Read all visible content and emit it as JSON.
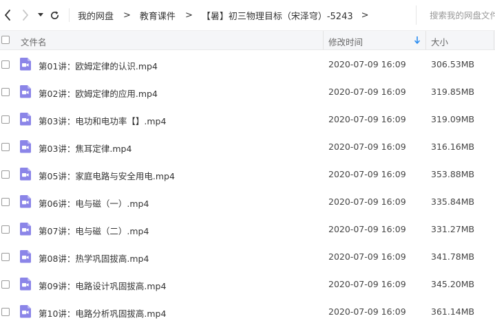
{
  "toolbar": {
    "breadcrumb": [
      "我的网盘",
      "教育课件",
      "【暑】初三物理目标（宋泽穹）-5243"
    ],
    "separator": ">",
    "search_placeholder": "搜索我的网盘文件"
  },
  "header": {
    "name_label": "文件名",
    "time_label": "修改时间",
    "size_label": "大小",
    "sort_icon": "arrow-down-icon"
  },
  "files": [
    {
      "name": "第01讲：欧姆定律的认识.mp4",
      "time": "2020-07-09 16:09",
      "size": "306.53MB"
    },
    {
      "name": "第02讲：欧姆定律的应用.mp4",
      "time": "2020-07-09 16:09",
      "size": "319.85MB"
    },
    {
      "name": "第03讲：电功和电功率【】.mp4",
      "time": "2020-07-09 16:09",
      "size": "319.09MB"
    },
    {
      "name": "第03讲：焦耳定律.mp4",
      "time": "2020-07-09 16:09",
      "size": "316.16MB"
    },
    {
      "name": "第05讲：家庭电路与安全用电.mp4",
      "time": "2020-07-09 16:09",
      "size": "353.88MB"
    },
    {
      "name": "第06讲：电与磁（一）.mp4",
      "time": "2020-07-09 16:09",
      "size": "335.84MB"
    },
    {
      "name": "第07讲：电与磁（二）.mp4",
      "time": "2020-07-09 16:09",
      "size": "331.27MB"
    },
    {
      "name": "第08讲：热学巩固拔高.mp4",
      "time": "2020-07-09 16:09",
      "size": "341.78MB"
    },
    {
      "name": "第09讲：电路设计巩固拔高.mp4",
      "time": "2020-07-09 16:09",
      "size": "345.20MB"
    },
    {
      "name": "第10讲：电路分析巩固拔高.mp4",
      "time": "2020-07-09 16:09",
      "size": "361.14MB"
    }
  ],
  "colors": {
    "video_icon": "#8b85e8",
    "sort_arrow": "#2a8cf0",
    "header_bg": "#f5f6f8"
  }
}
